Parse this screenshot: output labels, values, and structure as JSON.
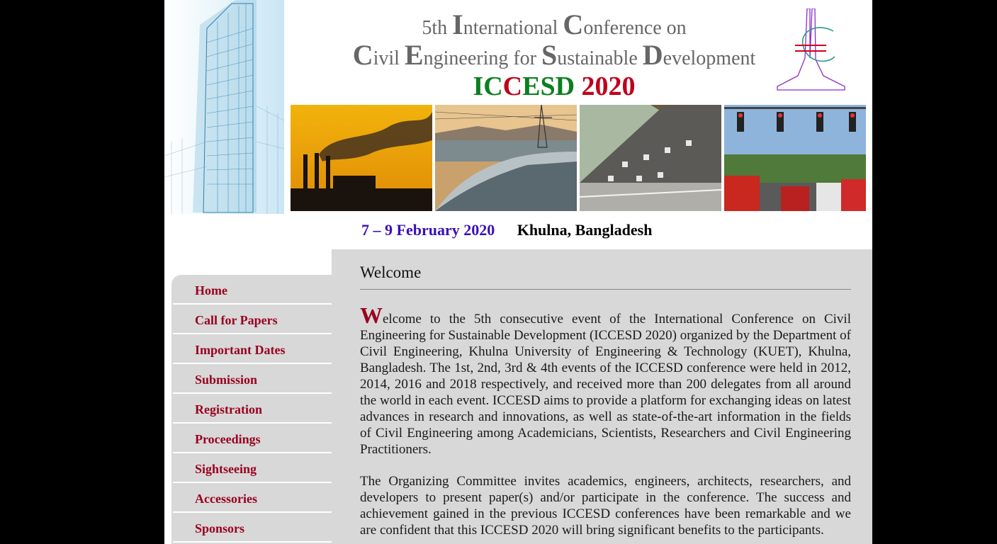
{
  "header": {
    "title_line1": [
      {
        "text": "5th ",
        "cap": false
      },
      {
        "text": "I",
        "cap": true
      },
      {
        "text": "nternational ",
        "cap": false
      },
      {
        "text": "C",
        "cap": true
      },
      {
        "text": "onference on",
        "cap": false
      }
    ],
    "title_line2": [
      {
        "text": "C",
        "cap": true
      },
      {
        "text": "ivil ",
        "cap": false
      },
      {
        "text": "E",
        "cap": true
      },
      {
        "text": "ngineering for ",
        "cap": false
      },
      {
        "text": "S",
        "cap": true
      },
      {
        "text": "ustainable ",
        "cap": false
      },
      {
        "text": "D",
        "cap": true
      },
      {
        "text": "evelopment",
        "cap": false
      }
    ],
    "acronym": [
      {
        "text": "IC",
        "color": "green"
      },
      {
        "text": "C",
        "color": "red"
      },
      {
        "text": "ESD",
        "color": "green"
      },
      {
        "text": " 2020",
        "color": "red"
      }
    ],
    "date": "7 – 9 February 2020",
    "location": "Khulna, Bangladesh"
  },
  "colors": {
    "title_gray": "#666666",
    "acronym_green": "#0b7f1f",
    "acronym_red": "#c0001b",
    "date_purple": "#3a0fb8",
    "nav_text": "#99001e",
    "panel_bg": "#d8d8d8"
  },
  "images": [
    "building-sketch-image",
    "smokestack-sunset-photo",
    "river-powerlines-photo",
    "slope-protection-photo",
    "traffic-lights-photo",
    "conference-logo"
  ],
  "sidebar": {
    "items": [
      {
        "label": "Home"
      },
      {
        "label": "Call for Papers"
      },
      {
        "label": "Important Dates"
      },
      {
        "label": "Submission"
      },
      {
        "label": "Registration"
      },
      {
        "label": "Proceedings"
      },
      {
        "label": "Sightseeing"
      },
      {
        "label": "Accessories"
      },
      {
        "label": "Sponsors"
      }
    ]
  },
  "main": {
    "heading": "Welcome",
    "dropcap": "W",
    "paragraph1": "elcome to the 5th consecutive event of the International Conference on Civil Engineering for Sustainable Development (ICCESD 2020) organized by the Department of Civil Engineering, Khulna University of Engineering & Technology (KUET), Khulna, Bangladesh. The 1st, 2nd, 3rd & 4th events of the ICCESD conference were held in 2012, 2014, 2016 and 2018 respectively, and received more than 200 delegates from all around the world in each event. ICCESD aims to provide a platform for exchanging ideas on latest advances in research and innovations, as well as state-of-the-art information in the fields of Civil Engineering among Academicians, Scientists, Researchers and Civil Engineering Practitioners.",
    "paragraph2": "The Organizing Committee invites academics, engineers, architects, researchers, and developers to present paper(s) and/or participate in the conference. The success and achievement gained in the previous ICCESD conferences have been remarkable and we are confident that this ICCESD 2020 will bring significant benefits to the participants."
  }
}
